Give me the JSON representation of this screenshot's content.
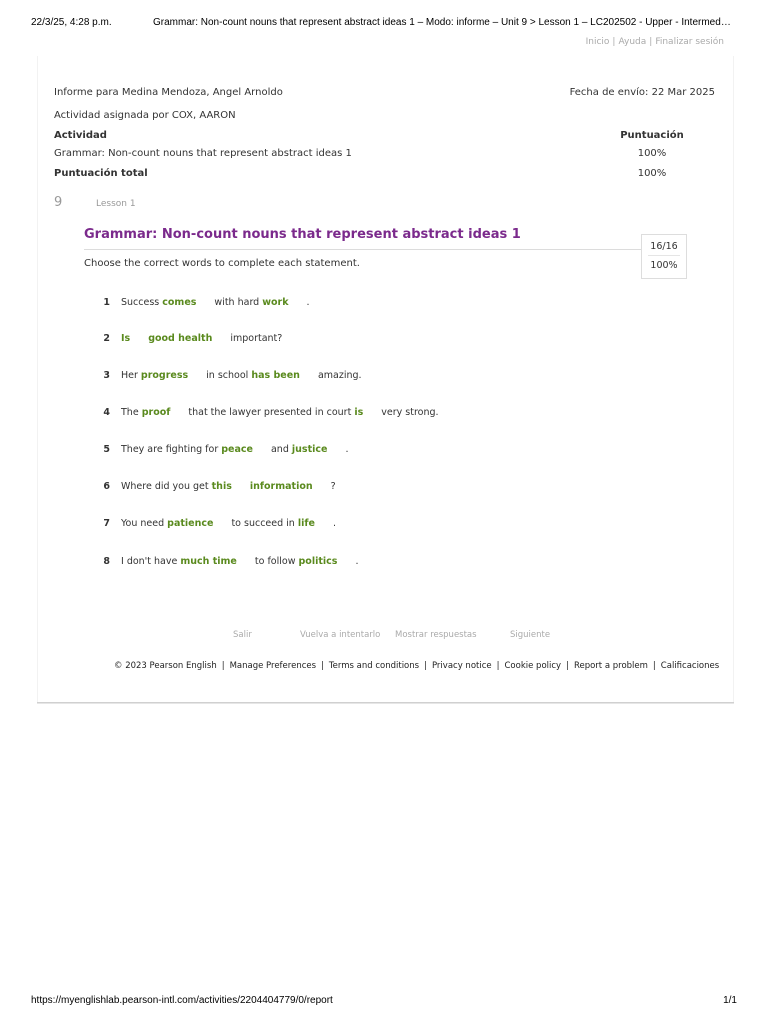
{
  "print_header": {
    "datetime": "22/3/25, 4:28 p.m.",
    "title": "Grammar: Non-count nouns that represent abstract ideas 1 – Modo: informe – Unit 9 > Lesson 1 – LC202502 - Upper - Intermediate..."
  },
  "print_footer": {
    "url": "https://myenglishlab.pearson-intl.com/activities/2204404779/0/report",
    "page": "1/1"
  },
  "topnav": {
    "home": "Inicio",
    "help": "Ayuda",
    "logout": "Finalizar sesión"
  },
  "report": {
    "for_label": "Informe para Medina Mendoza, Angel Arnoldo",
    "sent_label": "Fecha de envío: 22 Mar 2025",
    "assigned_by": "Actividad asignada por COX, AARON",
    "col_activity": "Actividad",
    "col_score": "Puntuación",
    "activity_name": "Grammar: Non-count nouns that represent abstract ideas 1",
    "activity_score": "100%",
    "total_label": "Puntuación total",
    "total_score": "100%"
  },
  "lesson": {
    "number": "9",
    "label": "Lesson 1"
  },
  "activity": {
    "title": "Grammar: Non-count nouns that represent abstract ideas 1",
    "instructions": "Choose the correct words to complete each statement.",
    "score_fraction": "16/16",
    "score_percent": "100%"
  },
  "questions": [
    {
      "num": "1",
      "parts": [
        {
          "t": "Success "
        },
        {
          "a": "comes"
        },
        {
          "t": "with hard "
        },
        {
          "a": "work"
        },
        {
          "t": "."
        }
      ]
    },
    {
      "num": "2",
      "parts": [
        {
          "a": "Is"
        },
        {
          "a": "good health"
        },
        {
          "t": "important?"
        }
      ]
    },
    {
      "num": "3",
      "parts": [
        {
          "t": "Her "
        },
        {
          "a": "progress"
        },
        {
          "t": "in school "
        },
        {
          "a": "has been"
        },
        {
          "t": "amazing."
        }
      ]
    },
    {
      "num": "4",
      "parts": [
        {
          "t": "The "
        },
        {
          "a": "proof"
        },
        {
          "t": "that the lawyer presented in court "
        },
        {
          "a": "is"
        },
        {
          "t": "very strong."
        }
      ]
    },
    {
      "num": "5",
      "parts": [
        {
          "t": "They are fighting for "
        },
        {
          "a": "peace"
        },
        {
          "t": "and "
        },
        {
          "a": "justice"
        },
        {
          "t": "."
        }
      ]
    },
    {
      "num": "6",
      "parts": [
        {
          "t": "Where did you get "
        },
        {
          "a": "this"
        },
        {
          "a": "information"
        },
        {
          "t": "?"
        }
      ]
    },
    {
      "num": "7",
      "parts": [
        {
          "t": "You need "
        },
        {
          "a": "patience"
        },
        {
          "t": "to succeed in "
        },
        {
          "a": "life"
        },
        {
          "t": "."
        }
      ]
    },
    {
      "num": "8",
      "parts": [
        {
          "t": "I don't have "
        },
        {
          "a": "much time"
        },
        {
          "t": "to follow "
        },
        {
          "a": "politics"
        },
        {
          "t": "."
        }
      ]
    }
  ],
  "actions": {
    "exit": "Salir",
    "retry": "Vuelva a intentarlo",
    "show_answers": "Mostrar respuestas",
    "next": "Siguiente"
  },
  "footer": {
    "copyright": "© 2023 Pearson English",
    "links": [
      "Manage Preferences",
      "Terms and conditions",
      "Privacy notice",
      "Cookie policy",
      "Report a problem",
      "Calificaciones"
    ]
  },
  "colors": {
    "title": "#7b2a8c",
    "answer": "#5a8a1e",
    "muted": "#aaaaaa"
  }
}
